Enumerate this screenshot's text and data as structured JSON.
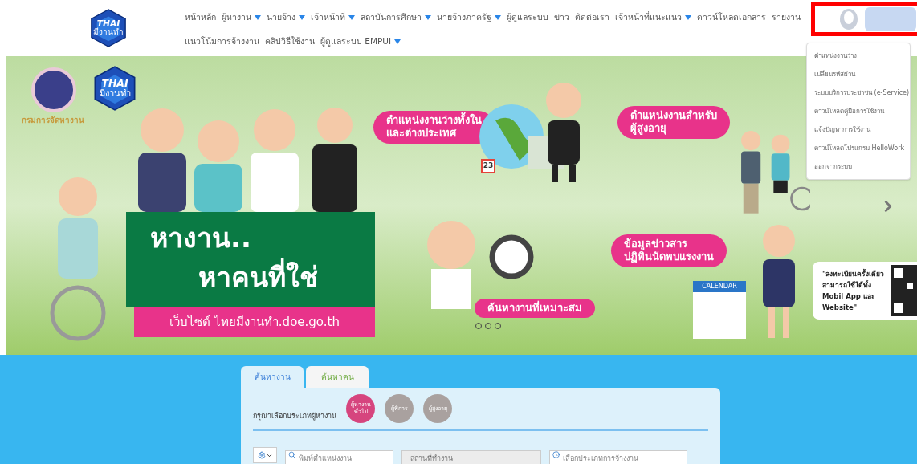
{
  "nav": {
    "logo": {
      "word": "THAI",
      "sub": "มีงานทำ"
    },
    "items": [
      {
        "label": "หน้าหลัก",
        "has_menu": false
      },
      {
        "label": "ผู้หางาน",
        "has_menu": true
      },
      {
        "label": "นายจ้าง",
        "has_menu": true
      },
      {
        "label": "เจ้าหน้าที่",
        "has_menu": true
      },
      {
        "label": "สถาบันการศึกษา",
        "has_menu": true
      },
      {
        "label": "นายจ้างภาครัฐ",
        "has_menu": true
      },
      {
        "label": "ผู้ดูแลระบบ",
        "has_menu": false
      },
      {
        "label": "ข่าว",
        "has_menu": false
      },
      {
        "label": "ติดต่อเรา",
        "has_menu": false
      },
      {
        "label": "เจ้าหน้าที่แนะแนว",
        "has_menu": true
      },
      {
        "label": "ดาวน์โหลดเอกสาร",
        "has_menu": false
      },
      {
        "label": "รายงาน",
        "has_menu": false
      },
      {
        "label": "แนวโน้มการจ้างงาน",
        "has_menu": false
      },
      {
        "label": "คลิปวิธีใช้งาน",
        "has_menu": false
      },
      {
        "label": "ผู้ดูแลระบบ EMPUI",
        "has_menu": true
      }
    ]
  },
  "user_menu": {
    "highlighted": true,
    "items": [
      "ตำแหน่งงานว่าง",
      "เปลี่ยนรหัสผ่าน",
      "ระบบบริการประชาชน (e-Service)",
      "ดาวน์โหลดคู่มือการใช้งาน",
      "แจ้งปัญหาการใช้งาน",
      "ดาวน์โหลดโปรแกรม HelloWork",
      "ออกจากระบบ"
    ]
  },
  "banner": {
    "seal_caption": "กรมการจัดหางาน",
    "logo": {
      "word": "THAI",
      "sub": "มีงานทำ"
    },
    "headline": [
      "หางาน..",
      "หาคนที่ใช่"
    ],
    "website": "เว็บไซต์ ไทยมีงานทำ.doe.go.th",
    "callouts": [
      "ตำแหน่งงานว่างทั้งใน\nและต่างประเทศ",
      "ตำแหน่งงานสำหรับ\nผู้สูงอายุ",
      "ข้อมูลข่าวสาร\nปฏิทินนัดพบแรงงาน",
      "ค้นหางานที่เหมาะสม"
    ],
    "calendar_title": "CALENDAR",
    "date_badge": "23",
    "qr_text": "\"ลงทะเบียนครั้งเดียว\nสามารถใช้ได้ทั้ง\nMobil App และ\nWebsite\""
  },
  "search": {
    "tabs": [
      {
        "label": "ค้นหางาน",
        "selected": true
      },
      {
        "label": "ค้นหาคน",
        "selected": false
      }
    ],
    "prompt": "กรุณาเลือกประเภทผู้หางาน",
    "seeker_types": [
      {
        "label": "ผู้หางาน\nทั่วไป",
        "selected": true
      },
      {
        "label": "ผู้พิการ",
        "selected": false
      },
      {
        "label": "ผู้สูงอายุ",
        "selected": false
      }
    ],
    "fields": [
      {
        "placeholder": "พิมพ์ตำแหน่งงาน",
        "disabled": false
      },
      {
        "placeholder": "สถานที่ทำงาน",
        "disabled": true
      },
      {
        "placeholder": "เลือกประเภทการจ้างงาน",
        "disabled": false
      }
    ]
  }
}
